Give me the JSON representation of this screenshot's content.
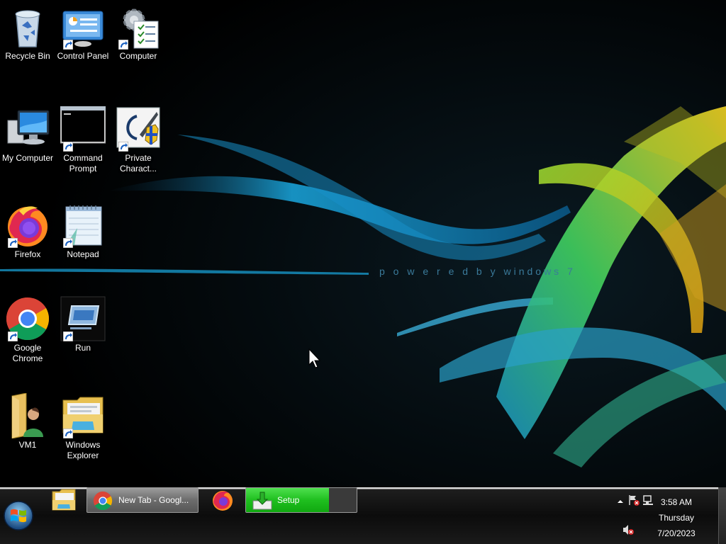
{
  "desktop": {
    "icons": [
      {
        "label": "Recycle Bin"
      },
      {
        "label": "Control Panel"
      },
      {
        "label": "Computer"
      },
      {
        "label": "My Computer"
      },
      {
        "label": "Command Prompt"
      },
      {
        "label": "Private Charact..."
      },
      {
        "label": "Firefox"
      },
      {
        "label": "Notepad"
      },
      {
        "label": "Google Chrome"
      },
      {
        "label": "Run"
      },
      {
        "label": "VM1"
      },
      {
        "label": "Windows Explorer"
      }
    ]
  },
  "wallpaper": {
    "text": "p o w e r e d  b y   windows 7"
  },
  "taskbar": {
    "buttons": [
      {
        "label": "New Tab - Googl..."
      },
      {
        "label": "Setup",
        "progress": 0.75
      }
    ]
  },
  "tray": {
    "time": "3:58 AM",
    "day": "Thursday",
    "date": "7/20/2023"
  },
  "colors": {
    "progress_green": "#1fbf1f",
    "wallpaper_cyan": "#1aa8e0",
    "wallpaper_yellow": "#f0d020"
  }
}
